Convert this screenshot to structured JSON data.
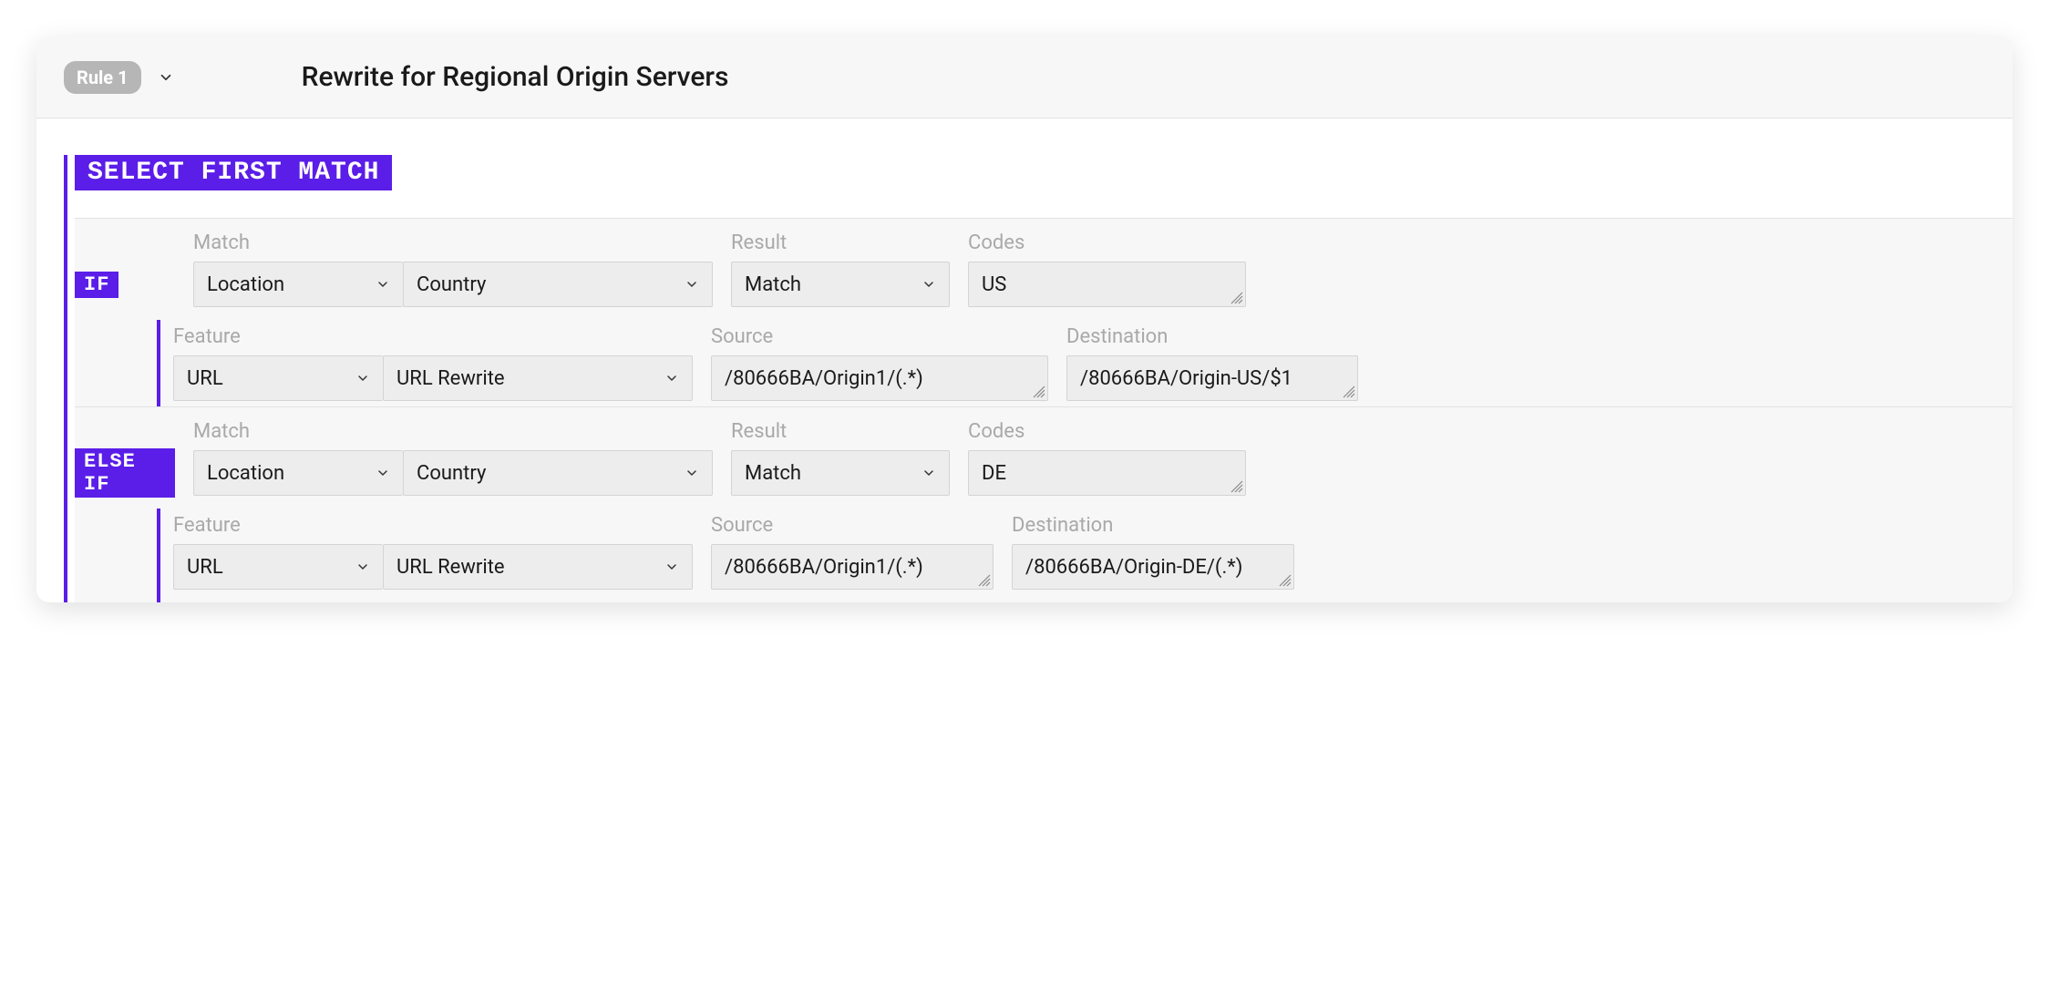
{
  "colors": {
    "accent": "#5b1de8",
    "badge_bg": "#b6b6b6"
  },
  "header": {
    "rule_badge": "Rule 1",
    "title": "Rewrite for Regional Origin Servers"
  },
  "select_first_match_label": "SELECT FIRST MATCH",
  "labels": {
    "match": "Match",
    "result": "Result",
    "codes": "Codes",
    "feature": "Feature",
    "source": "Source",
    "destination": "Destination"
  },
  "keywords": {
    "if": "IF",
    "else_if": "ELSE IF"
  },
  "blocks": [
    {
      "match": {
        "category": "Location",
        "field": "Country",
        "result": "Match",
        "codes": "US"
      },
      "feature": {
        "category": "URL",
        "action": "URL Rewrite",
        "source": "/80666BA/Origin1/(.*)",
        "destination": "/80666BA/Origin-US/$1"
      }
    },
    {
      "match": {
        "category": "Location",
        "field": "Country",
        "result": "Match",
        "codes": "DE"
      },
      "feature": {
        "category": "URL",
        "action": "URL Rewrite",
        "source": "/80666BA/Origin1/(.*)",
        "destination": "/80666BA/Origin-DE/(.*)"
      }
    }
  ]
}
